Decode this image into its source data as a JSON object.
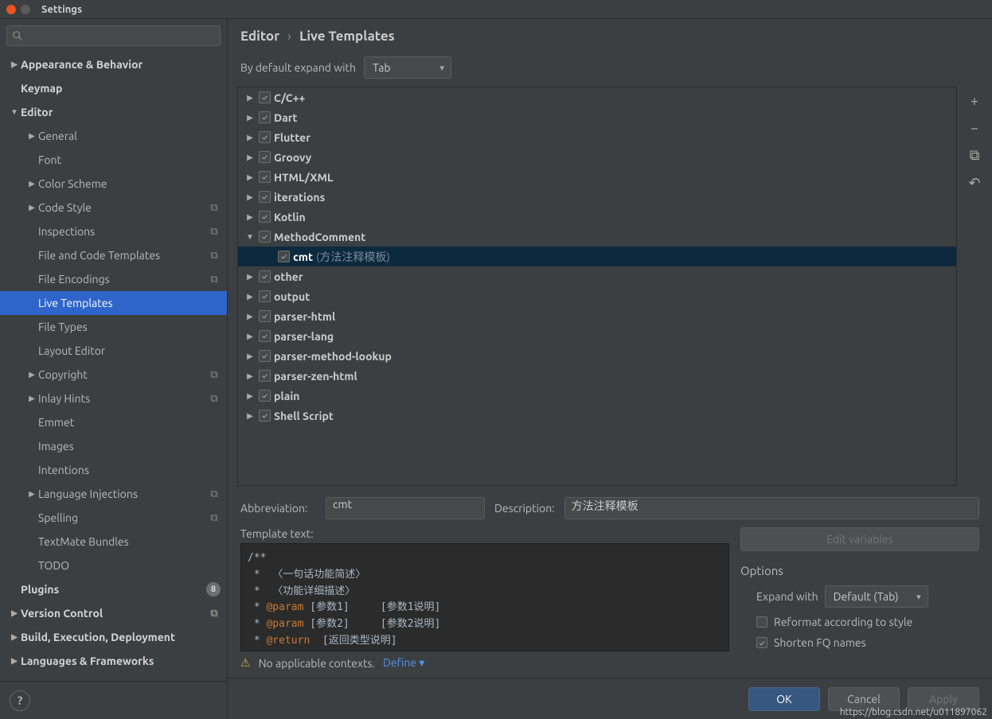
{
  "window": {
    "title": "Settings"
  },
  "breadcrumb": {
    "part1": "Editor",
    "sep": "›",
    "part2": "Live Templates"
  },
  "expandDefault": {
    "label": "By default expand with",
    "value": "Tab"
  },
  "sidebar": {
    "items": [
      {
        "label": "Appearance & Behavior",
        "bold": true,
        "indent": 0,
        "arrow": "▶"
      },
      {
        "label": "Keymap",
        "bold": true,
        "indent": 0,
        "arrow": ""
      },
      {
        "label": "Editor",
        "bold": true,
        "indent": 0,
        "arrow": "▼"
      },
      {
        "label": "General",
        "indent": 1,
        "arrow": "▶"
      },
      {
        "label": "Font",
        "indent": 1,
        "arrow": ""
      },
      {
        "label": "Color Scheme",
        "indent": 1,
        "arrow": "▶"
      },
      {
        "label": "Code Style",
        "indent": 1,
        "arrow": "▶",
        "gear": true
      },
      {
        "label": "Inspections",
        "indent": 1,
        "arrow": "",
        "gear": true
      },
      {
        "label": "File and Code Templates",
        "indent": 1,
        "arrow": "",
        "gear": true
      },
      {
        "label": "File Encodings",
        "indent": 1,
        "arrow": "",
        "gear": true
      },
      {
        "label": "Live Templates",
        "indent": 1,
        "arrow": "",
        "selected": true
      },
      {
        "label": "File Types",
        "indent": 1,
        "arrow": ""
      },
      {
        "label": "Layout Editor",
        "indent": 1,
        "arrow": ""
      },
      {
        "label": "Copyright",
        "indent": 1,
        "arrow": "▶",
        "gear": true
      },
      {
        "label": "Inlay Hints",
        "indent": 1,
        "arrow": "▶",
        "gear": true
      },
      {
        "label": "Emmet",
        "indent": 1,
        "arrow": ""
      },
      {
        "label": "Images",
        "indent": 1,
        "arrow": ""
      },
      {
        "label": "Intentions",
        "indent": 1,
        "arrow": ""
      },
      {
        "label": "Language Injections",
        "indent": 1,
        "arrow": "▶",
        "gear": true
      },
      {
        "label": "Spelling",
        "indent": 1,
        "arrow": "",
        "gear": true
      },
      {
        "label": "TextMate Bundles",
        "indent": 1,
        "arrow": ""
      },
      {
        "label": "TODO",
        "indent": 1,
        "arrow": ""
      },
      {
        "label": "Plugins",
        "bold": true,
        "indent": 0,
        "arrow": "",
        "badge": "8"
      },
      {
        "label": "Version Control",
        "bold": true,
        "indent": 0,
        "arrow": "▶",
        "gear": true
      },
      {
        "label": "Build, Execution, Deployment",
        "bold": true,
        "indent": 0,
        "arrow": "▶"
      },
      {
        "label": "Languages & Frameworks",
        "bold": true,
        "indent": 0,
        "arrow": "▶"
      }
    ]
  },
  "tree": {
    "items": [
      {
        "label": "C/C++",
        "arrow": "▶"
      },
      {
        "label": "Dart",
        "arrow": "▶"
      },
      {
        "label": "Flutter",
        "arrow": "▶"
      },
      {
        "label": "Groovy",
        "arrow": "▶"
      },
      {
        "label": "HTML/XML",
        "arrow": "▶"
      },
      {
        "label": "iterations",
        "arrow": "▶"
      },
      {
        "label": "Kotlin",
        "arrow": "▶"
      },
      {
        "label": "MethodComment",
        "arrow": "▼"
      },
      {
        "label": "cmt",
        "sublabel": "(方法注释模板)",
        "indent": 1,
        "selected": true,
        "arrow": ""
      },
      {
        "label": "other",
        "arrow": "▶"
      },
      {
        "label": "output",
        "arrow": "▶"
      },
      {
        "label": "parser-html",
        "arrow": "▶"
      },
      {
        "label": "parser-lang",
        "arrow": "▶"
      },
      {
        "label": "parser-method-lookup",
        "arrow": "▶"
      },
      {
        "label": "parser-zen-html",
        "arrow": "▶"
      },
      {
        "label": "plain",
        "arrow": "▶"
      },
      {
        "label": "Shell Script",
        "arrow": "▶"
      }
    ]
  },
  "detail": {
    "abbrevLabel": "Abbreviation:",
    "abbrevValue": "cmt",
    "descLabel": "Description:",
    "descValue": "方法注释模板",
    "templateTextLabel": "Template text:",
    "templateText": "/**\n *  〈一句话功能简述〉\n *  〈功能详细描述〉\n * @param [参数1]     [参数1说明]\n * @param [参数2]     [参数2说明]\n * @return  [返回类型说明]\n * @exception/throws [违例类型] [违例说明]",
    "editVariables": "Edit variables",
    "optionsTitle": "Options",
    "expandWithLabel": "Expand with",
    "expandWithValue": "Default (Tab)",
    "reformat": "Reformat according to style",
    "shorten": "Shorten FQ names"
  },
  "context": {
    "warnText": "No applicable contexts.",
    "defineText": "Define"
  },
  "buttons": {
    "ok": "OK",
    "cancel": "Cancel",
    "apply": "Apply"
  },
  "watermark": "https://blog.csdn.net/u011897062",
  "toolIcons": {
    "add": "+",
    "remove": "−",
    "copy": "⧉",
    "revert": "↶"
  }
}
